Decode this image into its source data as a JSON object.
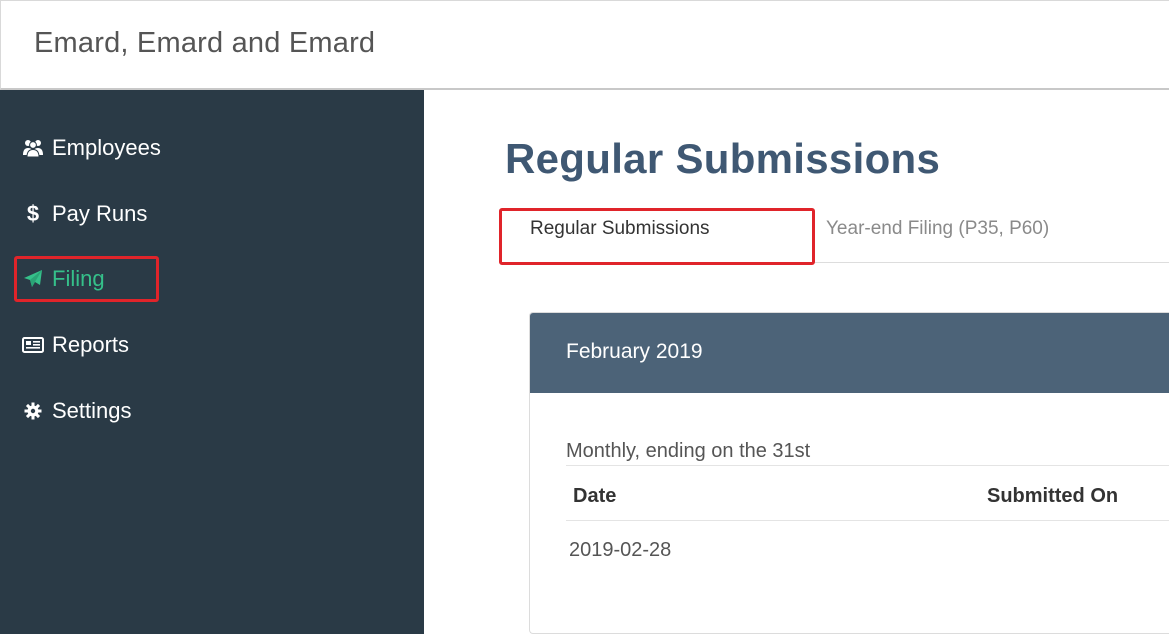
{
  "app": {
    "title": "Emard, Emard and Emard"
  },
  "sidebar": {
    "items": [
      {
        "label": "Employees",
        "icon": "users-icon",
        "active": false
      },
      {
        "label": "Pay Runs",
        "icon": "dollar-icon",
        "active": false
      },
      {
        "label": "Filing",
        "icon": "paper-plane-icon",
        "active": true
      },
      {
        "label": "Reports",
        "icon": "report-card-icon",
        "active": false
      },
      {
        "label": "Settings",
        "icon": "gear-icon",
        "active": false
      }
    ]
  },
  "main": {
    "title": "Regular Submissions",
    "tabs": [
      {
        "label": "Regular Submissions",
        "active": true
      },
      {
        "label": "Year-end Filing (P35, P60)",
        "active": false
      }
    ],
    "panel": {
      "header": "February 2019",
      "schedule": "Monthly, ending on the 31st",
      "columns": [
        "Date",
        "Submitted On"
      ],
      "rows": [
        {
          "date": "2019-02-28",
          "submitted_on": ""
        }
      ]
    }
  },
  "colors": {
    "sidebar_bg": "#2a3a46",
    "active_nav": "#35c08a",
    "title": "#3f5873",
    "panel_header": "#4c6378",
    "highlight": "#e0242a"
  }
}
